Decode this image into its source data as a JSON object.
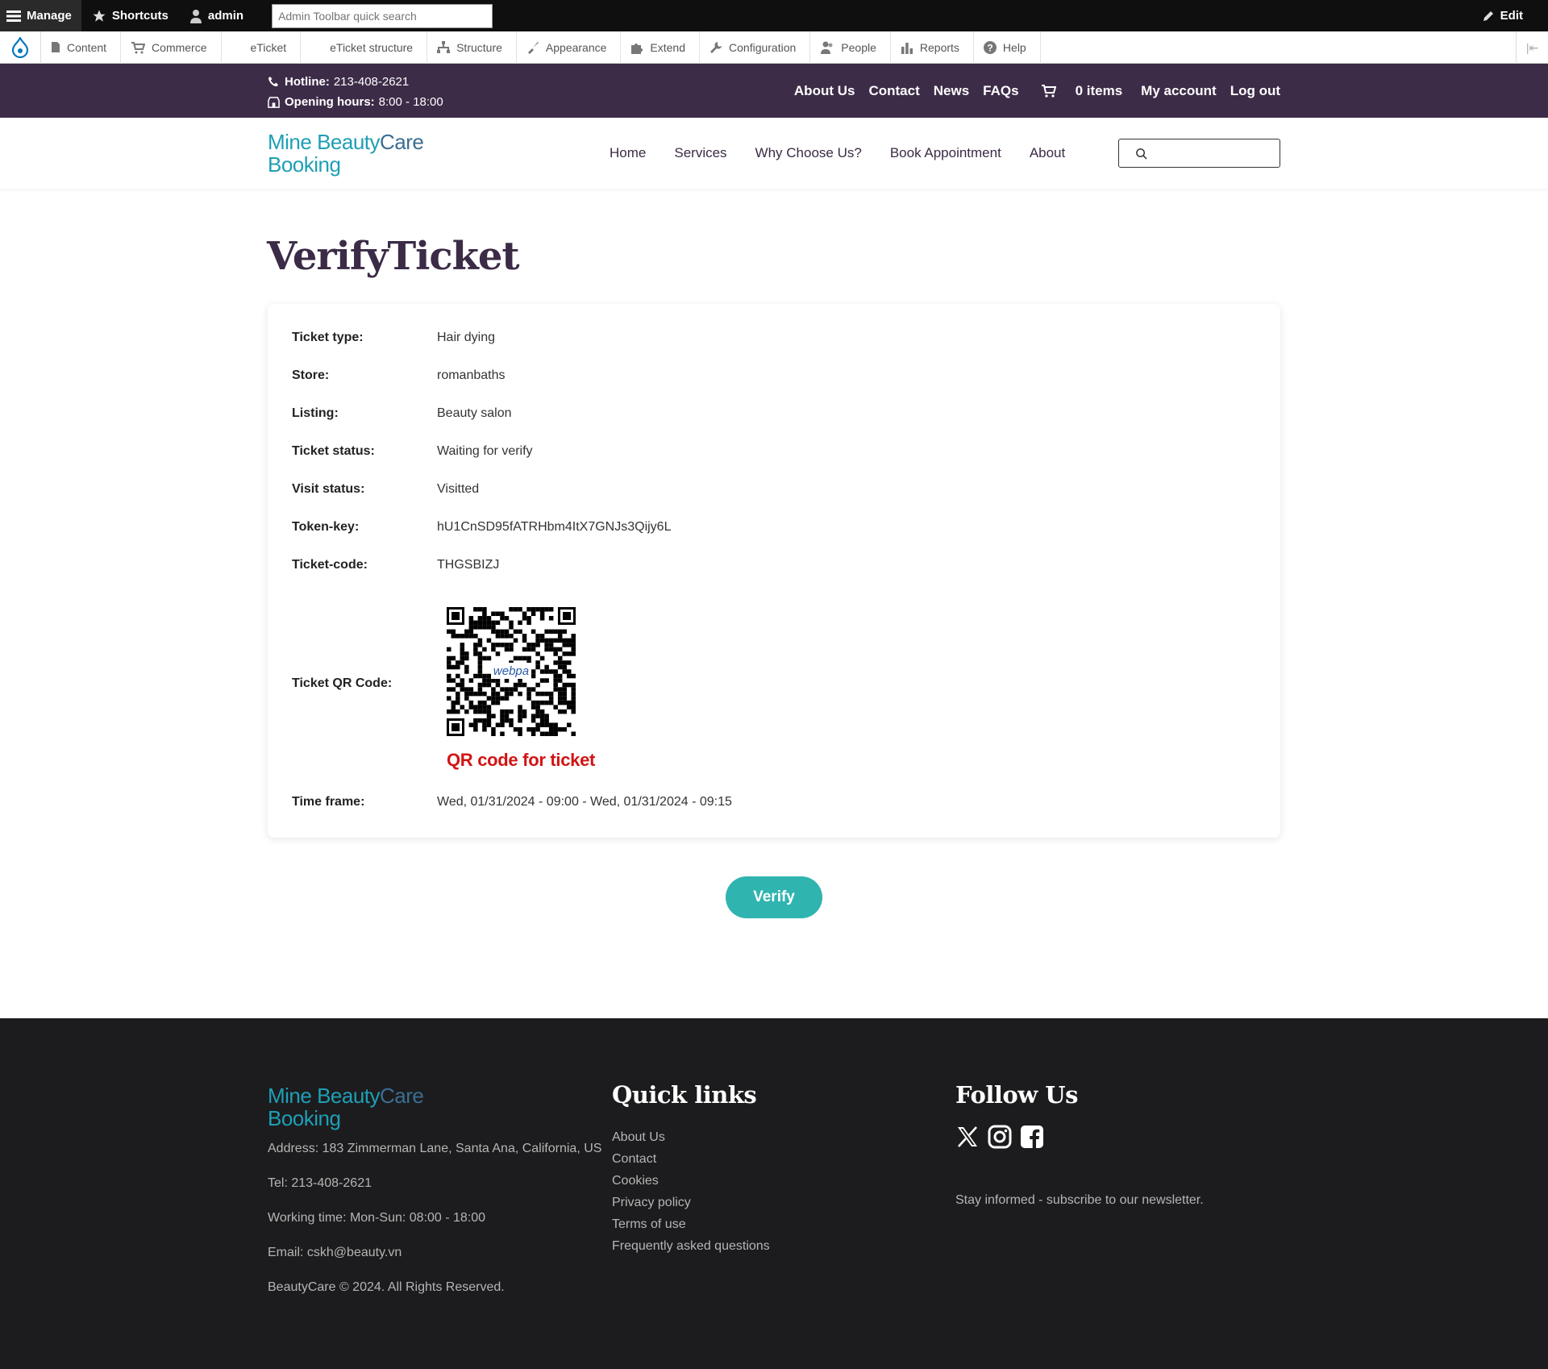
{
  "admin_toolbar": {
    "manage": "Manage",
    "shortcuts": "Shortcuts",
    "user": "admin",
    "search_placeholder": "Admin Toolbar quick search",
    "edit": "Edit"
  },
  "admin_tray": {
    "items": [
      "Content",
      "Commerce",
      "eTicket",
      "eTicket structure",
      "Structure",
      "Appearance",
      "Extend",
      "Configuration",
      "People",
      "Reports",
      "Help"
    ]
  },
  "topbar": {
    "hotline_label": "Hotline:",
    "hotline_value": "213-408-2621",
    "hours_label": "Opening hours:",
    "hours_value": "8:00 - 18:00",
    "links": [
      "About Us",
      "Contact",
      "News",
      "FAQs"
    ],
    "cart": "0 items",
    "account": "My account",
    "logout": "Log out"
  },
  "header": {
    "logo_line1_a": "Mine Beauty",
    "logo_line1_b": "Care",
    "logo_line2": "Booking",
    "nav": [
      "Home",
      "Services",
      "Why Choose Us?",
      "Book Appointment",
      "About"
    ],
    "search_value": ""
  },
  "page": {
    "title": "VerifyTicket",
    "fields": [
      {
        "label": "Ticket type:",
        "value": "Hair dying"
      },
      {
        "label": "Store:",
        "value": "romanbaths"
      },
      {
        "label": "Listing:",
        "value": "Beauty salon"
      },
      {
        "label": "Ticket status:",
        "value": "Waiting for verify"
      },
      {
        "label": "Visit status:",
        "value": "Visitted"
      },
      {
        "label": "Token-key:",
        "value": "hU1CnSD95fATRHbm4ItX7GNJs3Qijy6L"
      },
      {
        "label": "Ticket-code:",
        "value": "THGSBIZJ"
      }
    ],
    "qr_label": "Ticket QR Code:",
    "qr_logo_text": "webpa",
    "qr_caption": "QR code for ticket",
    "timeframe_label": "Time frame:",
    "timeframe_value": "Wed, 01/31/2024 - 09:00 - Wed, 01/31/2024 - 09:15",
    "verify_button": "Verify"
  },
  "footer": {
    "address": "Address: 183 Zimmerman Lane, Santa Ana, California, US",
    "tel": "Tel: 213-408-2621",
    "working": "Working time: Mon-Sun: 08:00 - 18:00",
    "email": "Email: cskh@beauty.vn",
    "copyright": "BeautyCare © 2024. All Rights Reserved.",
    "quick_links_title": "Quick links",
    "quick_links": [
      "About Us",
      "Contact",
      "Cookies",
      "Privacy policy",
      "Terms of use",
      "Frequently asked questions"
    ],
    "follow_title": "Follow Us",
    "social_icons": [
      "x-icon",
      "instagram-icon",
      "facebook-icon"
    ],
    "newsletter": "Stay informed - subscribe to our newsletter."
  },
  "colors": {
    "topbar_bg": "#3d2c48",
    "accent": "#2fb4b0",
    "logo_blue": "#1e9fb5",
    "qr_caption": "#d21414",
    "footer_bg": "#1c1c1e"
  }
}
